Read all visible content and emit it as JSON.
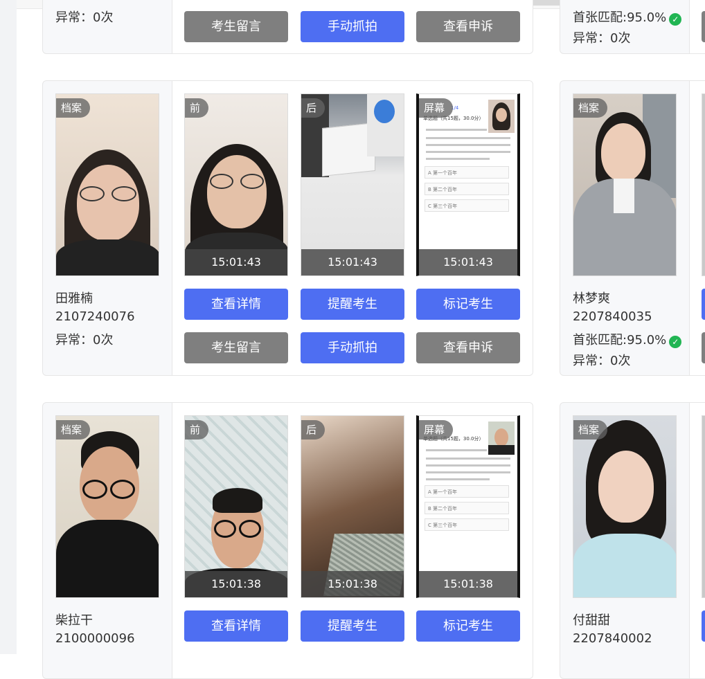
{
  "tags": {
    "archive": "档案",
    "front": "前",
    "back": "后",
    "screen": "屏幕"
  },
  "buttons": {
    "detail": "查看详情",
    "remind": "提醒考生",
    "mark": "标记考生",
    "message": "考生留言",
    "capture": "手动抓拍",
    "appeal": "查看申诉"
  },
  "screen_text": {
    "count1": "1/4",
    "q_title": "单选题（共15题，30.0分）",
    "q_title2": "单选题（共15题，30.0分）",
    "opt_a": "A  第一个百年",
    "opt_b": "B  第二个百年",
    "opt_c": "C  第三个百年"
  },
  "top_left": {
    "abnormal": "异常：0次"
  },
  "top_right": {
    "match": "首张匹配:95.0%",
    "abnormal": "异常：0次"
  },
  "row1_left": {
    "name": "田雅楠",
    "id": "2107240076",
    "abnormal": "异常：0次",
    "times": [
      "15:01:43",
      "15:01:43",
      "15:01:43"
    ]
  },
  "row1_right": {
    "name": "林梦爽",
    "id": "2207840035",
    "match": "首张匹配:95.0%",
    "abnormal": "异常：0次"
  },
  "row2_left": {
    "name": "柴拉干",
    "id": "2100000096",
    "times": [
      "15:01:38",
      "15:01:38",
      "15:01:38"
    ]
  },
  "row2_right": {
    "name": "付甜甜",
    "id": "2207840002"
  },
  "colors": {
    "primary": "#4e6ef2",
    "secondary": "#7f7f7f",
    "success": "#21b553"
  }
}
